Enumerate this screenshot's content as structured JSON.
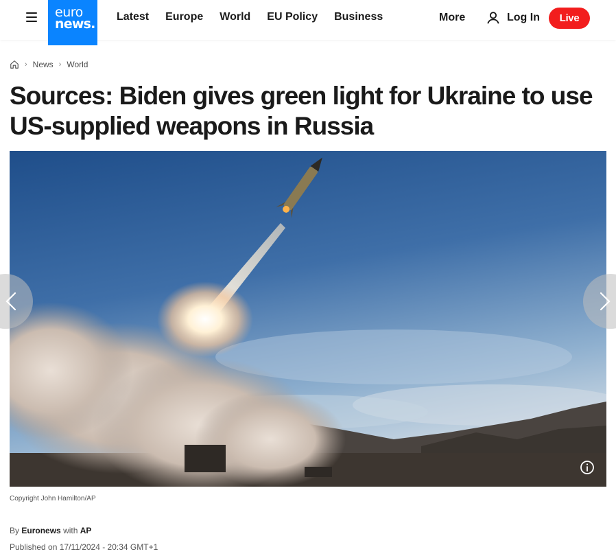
{
  "header": {
    "logo_line1": "euro",
    "logo_line2": "news.",
    "nav": [
      "Latest",
      "Europe",
      "World",
      "EU Policy",
      "Business"
    ],
    "more_label": "More",
    "login_label": "Log In",
    "live_label": "Live",
    "brand_color": "#0a84ff",
    "live_color": "#f21d1d"
  },
  "breadcrumb": {
    "items": [
      "News",
      "World"
    ]
  },
  "article": {
    "title": "Sources: Biden gives green light for Ukraine to use US-supplied weapons in Russia",
    "image_copyright": "Copyright John Hamilton/AP",
    "byline_prefix": "By",
    "author": "Euronews",
    "byline_with": "with",
    "agency": "AP",
    "published": "Published on 17/11/2024 - 20:34 GMT+1"
  },
  "icons": {
    "menu": "hamburger-icon",
    "home": "home-icon",
    "user": "user-icon",
    "info": "info-icon",
    "prev": "chevron-left-icon",
    "next": "chevron-right-icon"
  }
}
